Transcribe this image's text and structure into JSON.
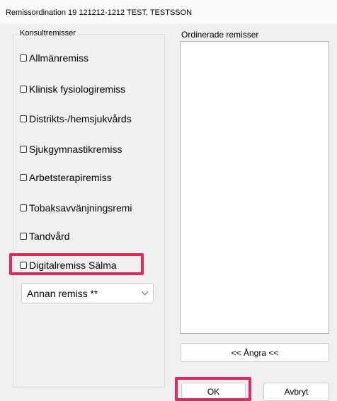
{
  "window": {
    "title": "Remissordination 19 121212-1212 TEST, TESTSSON"
  },
  "consult_group": {
    "legend": "Konsultremisser",
    "items": [
      {
        "label": "Allmänremiss",
        "checked": false
      },
      {
        "label": "Klinisk fysiologiremiss",
        "checked": false
      },
      {
        "label": "Distrikts-/hemsjukvårds",
        "checked": false
      },
      {
        "label": "Sjukgymnastikremiss",
        "checked": false
      },
      {
        "label": "Arbetsterapiremiss",
        "checked": false
      },
      {
        "label": "Tobaksavvänjningsremi",
        "checked": false
      },
      {
        "label": "Tandvård",
        "checked": false
      },
      {
        "label": "Digitalremiss Sälma",
        "checked": false,
        "highlighted": true
      }
    ],
    "other_select": {
      "value": "Annan remiss **"
    }
  },
  "ordered_list": {
    "label": "Ordinerade remisser",
    "items": []
  },
  "buttons": {
    "undo": "<< Ångra <<",
    "ok": "OK",
    "cancel": "Avbryt"
  },
  "colors": {
    "highlight": "#e0285f",
    "background": "#f0f0f0"
  }
}
